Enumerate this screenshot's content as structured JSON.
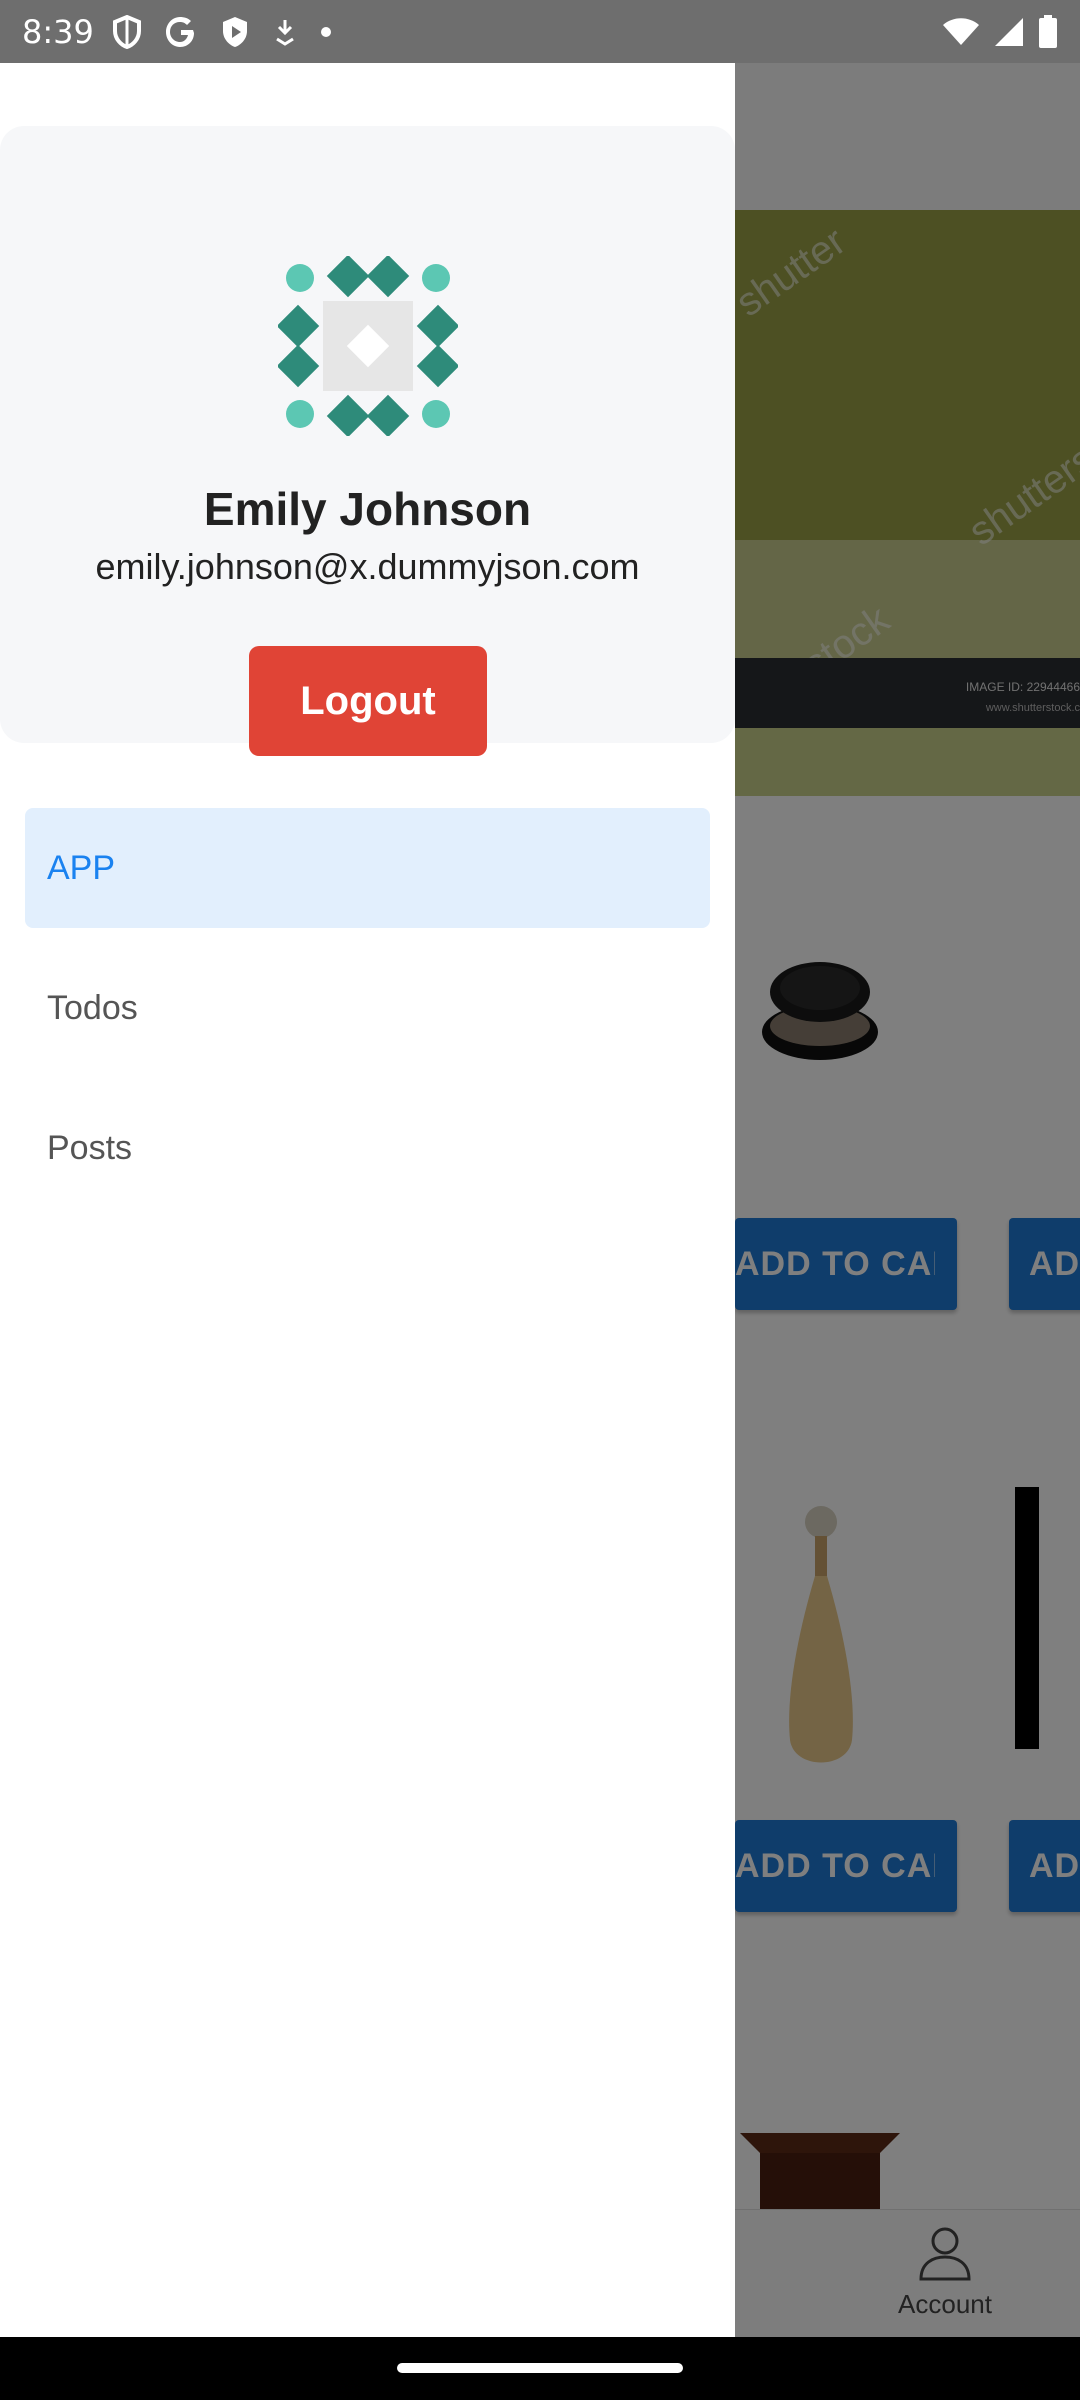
{
  "status_bar": {
    "time": "8:39",
    "icons_left": [
      "shield-icon",
      "google-icon",
      "play-protect-icon",
      "download-icon",
      "dot-icon"
    ],
    "icons_right": [
      "wifi-icon",
      "signal-icon",
      "battery-icon"
    ]
  },
  "drawer": {
    "profile": {
      "name": "Emily Johnson",
      "email": "emily.johnson@x.dummyjson.com",
      "logout_label": "Logout"
    },
    "nav_items": [
      {
        "label": "APP",
        "active": true
      },
      {
        "label": "Todos",
        "active": false
      },
      {
        "label": "Posts",
        "active": false
      }
    ]
  },
  "background": {
    "add_to_cart_label": "ADD TO CART",
    "account_tab_label": "Account",
    "banner_image_id": "IMAGE ID: 22944466",
    "banner_site": "www.shutterstock.c",
    "banner_watermarks": [
      "shutter",
      "shutterst",
      "stock"
    ]
  },
  "colors": {
    "accent_blue": "#1a82f0",
    "nav_active_bg": "#e2effd",
    "logout_red": "#e04436",
    "card_bg": "#f6f7f9",
    "avatar_dark": "#2e8b7a",
    "avatar_light": "#5cc7b3"
  }
}
